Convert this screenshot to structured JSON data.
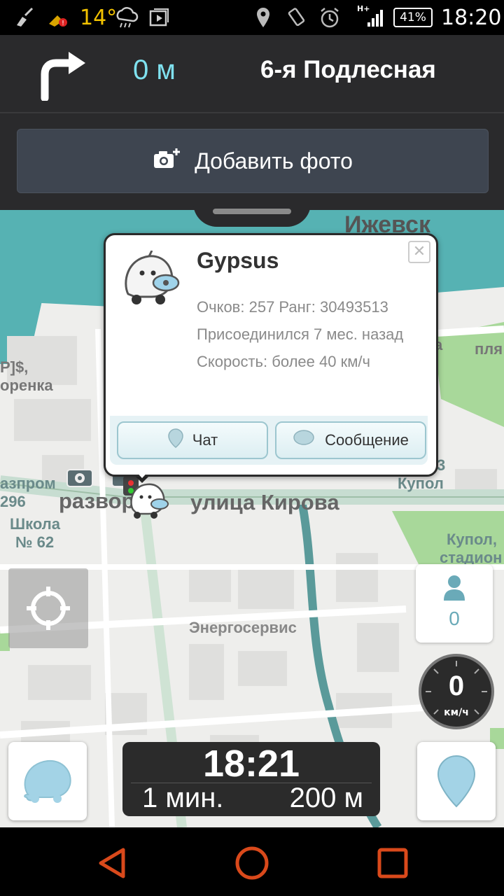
{
  "status_bar": {
    "temperature": "14°",
    "network": "H+",
    "battery": "41%",
    "time": "18:20"
  },
  "navigation": {
    "distance": "0 м",
    "street": "6-я Подлесная",
    "add_photo_label": "Добавить фото"
  },
  "map": {
    "labels": {
      "city": "Ижевск",
      "street_kirova": "улица Кирова",
      "razvor": "развор",
      "energoservis": "Энергосервис",
      "shkola": "Школа",
      "shkola_num": "№ 62",
      "gazprom": "азпром",
      "gazprom_num": "296",
      "kupol": "Купол",
      "kupol_num": "3",
      "kupol_stadium": "Купол,",
      "stadium": "стадион",
      "plya": "пля",
      "left_a": "P]$,",
      "left_b": "оренка",
      "edge_a": "а"
    }
  },
  "popup": {
    "name": "Gypsus",
    "points_rank": "Очков: 257 Ранг: 30493513",
    "joined": "Присоединился 7 мес. назад",
    "speed": "Скорость: более 40 км/ч",
    "chat_label": "Чат",
    "message_label": "Сообщение",
    "close_glyph": "✕"
  },
  "widgets": {
    "users_count": "0",
    "speed_value": "0",
    "speed_unit": "км/ч"
  },
  "eta": {
    "arrival_time": "18:21",
    "minutes": "1 мин.",
    "distance": "200 м"
  },
  "colors": {
    "accent": "#7fe1ef",
    "water": "#56b2b3",
    "park": "#a8d89a",
    "header": "#2a2a2c"
  }
}
